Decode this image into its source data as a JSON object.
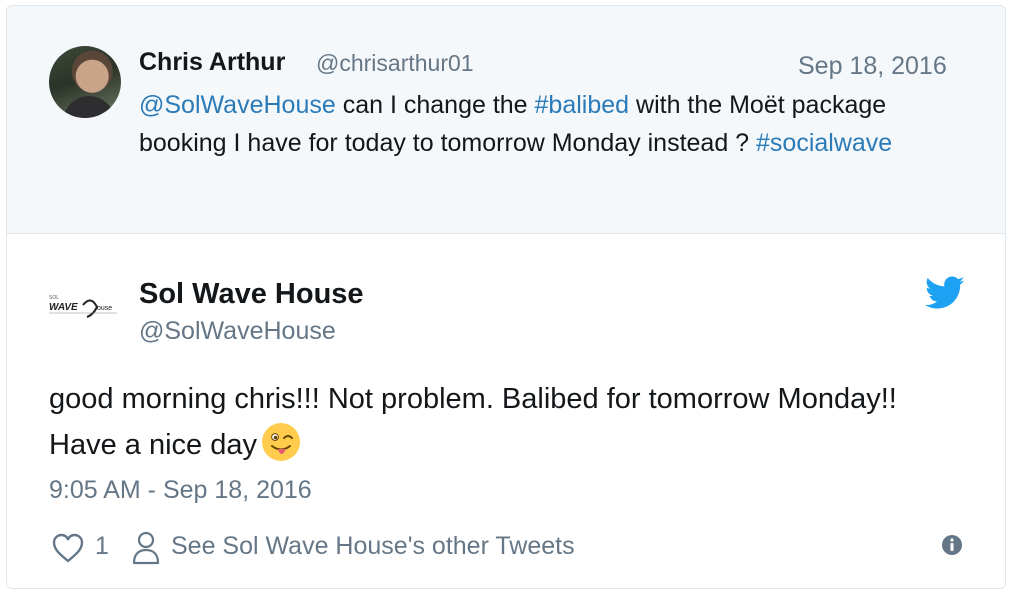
{
  "parent_tweet": {
    "author_name": "Chris Arthur",
    "author_handle": "@chrisarthur01",
    "date": "Sep 18, 2016",
    "text_parts": {
      "mention": "@SolWaveHouse",
      "t1": " can I change the ",
      "hashtag1": "#balibed",
      "t2": " with the Moët package booking I have for today to tomorrow Monday instead ? ",
      "hashtag2": "#socialwave"
    }
  },
  "reply_tweet": {
    "author_name": "Sol Wave House",
    "author_handle": "@SolWaveHouse",
    "text": "good morning chris!!! Not problem. Balibed for tomorrow Monday!! Have a nice day",
    "timestamp": "9:05 AM - Sep 18, 2016",
    "emoji": "winking-face-with-tongue"
  },
  "actions": {
    "like_count": "1",
    "see_more_label": "See Sol Wave House's other Tweets"
  },
  "colors": {
    "link": "#2b7bb9",
    "muted": "#657786",
    "twitter_blue": "#1da1f2",
    "parent_bg": "#f5f8fa"
  }
}
